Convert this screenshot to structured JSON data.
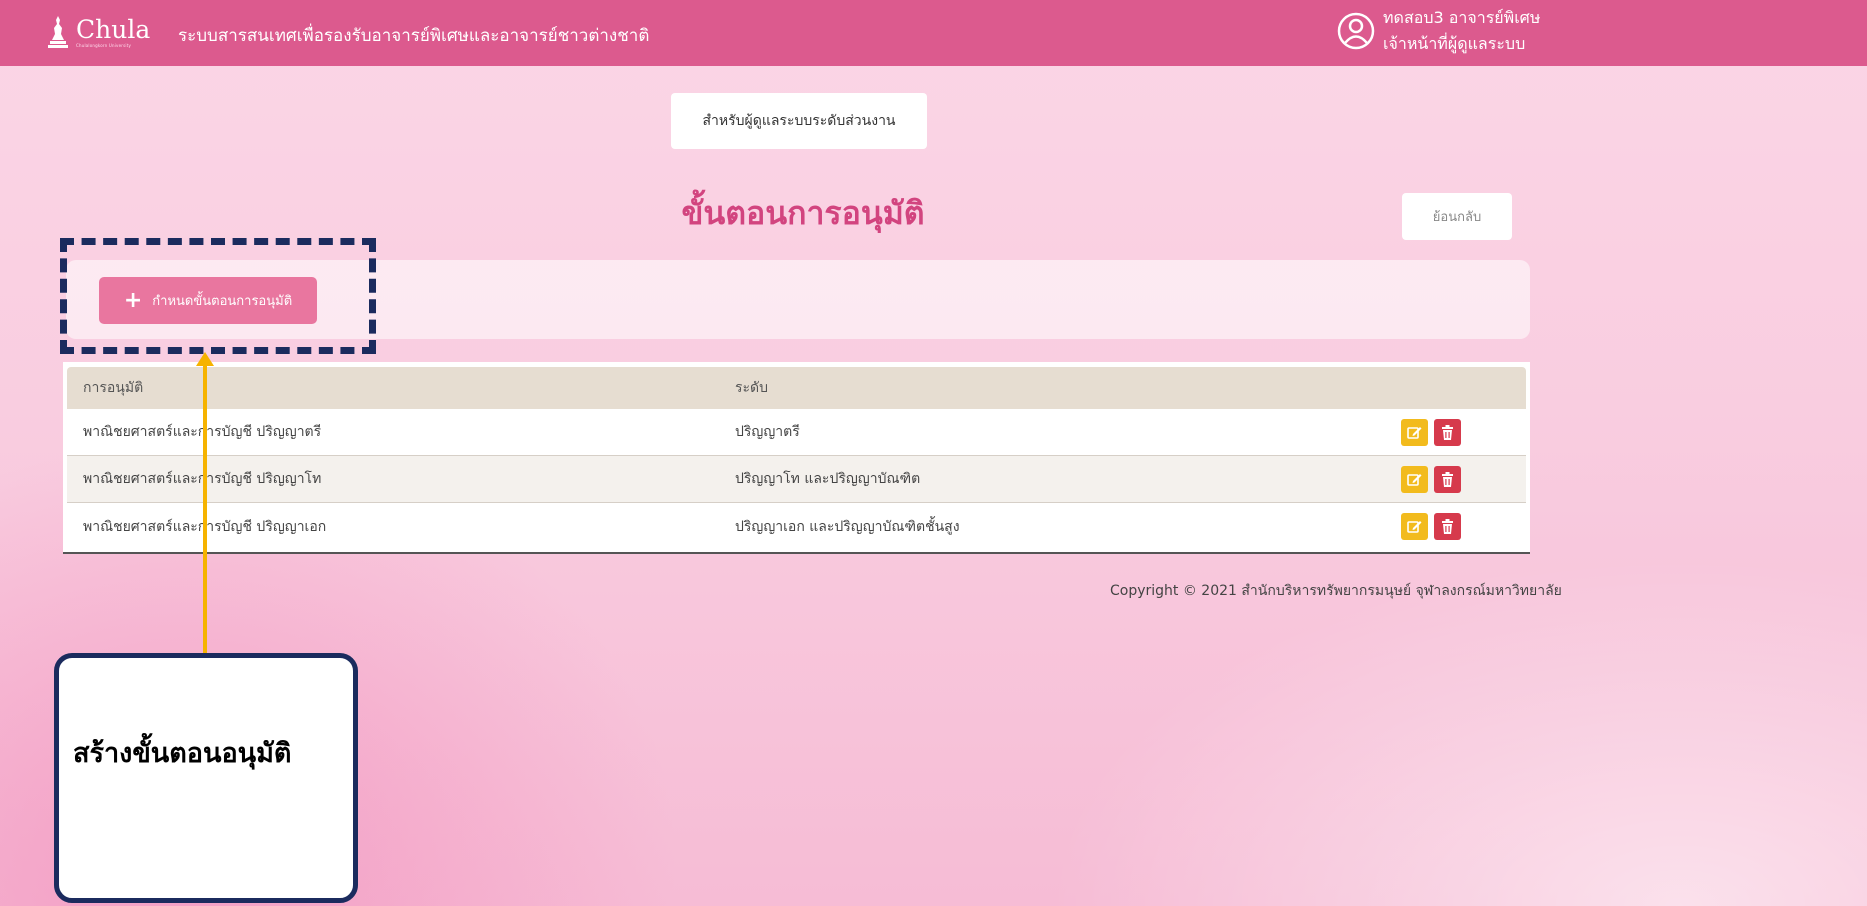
{
  "header": {
    "logo_word": "Chula",
    "logo_sub": "Chulalongkorn University",
    "system_title": "ระบบสารสนเทศเพื่อรองรับอาจารย์พิเศษและอาจารย์ชาวต่างชาติ",
    "user_name": "ทดสอบ3 อาจารย์พิเศษ",
    "user_role": "เจ้าหน้าที่ผู้ดูแลระบบ"
  },
  "context_label": "สำหรับผู้ดูแลระบบระดับส่วนงาน",
  "page_title": "ขั้นตอนการอนุมัติ",
  "back_label": "ย้อนกลับ",
  "add_button_label": "กำหนดขั้นตอนการอนุมัติ",
  "table": {
    "headers": [
      "การอนุมัติ",
      "ระดับ"
    ],
    "rows": [
      {
        "approval": "พาณิชยศาสตร์และการบัญชี ปริญญาตรี",
        "level": "ปริญญาตรี"
      },
      {
        "approval": "พาณิชยศาสตร์และการบัญชี ปริญญาโท",
        "level": "ปริญญาโท และปริญญาบัณฑิต"
      },
      {
        "approval": "พาณิชยศาสตร์และการบัญชี ปริญญาเอก",
        "level": "ปริญญาเอก และปริญญาบัณฑิตชั้นสูง"
      }
    ]
  },
  "copyright": "Copyright © 2021 สำนักบริหารทรัพยากรมนุษย์ จุฬาลงกรณ์มหาวิทยาลัย",
  "annotation": {
    "callout_text": "สร้างขั้นตอนอนุมัติ"
  },
  "icons": {
    "user": "user-circle-icon",
    "edit": "edit-icon",
    "delete": "trash-icon",
    "plus": "plus-icon"
  },
  "colors": {
    "header": "#dc5a8e",
    "title": "#d2447f",
    "add_button": "#e9769f",
    "edit": "#f2bb1d",
    "delete": "#d63a4c",
    "annotation_border": "#1b2b5e",
    "annotation_arrow": "#f6b300"
  }
}
